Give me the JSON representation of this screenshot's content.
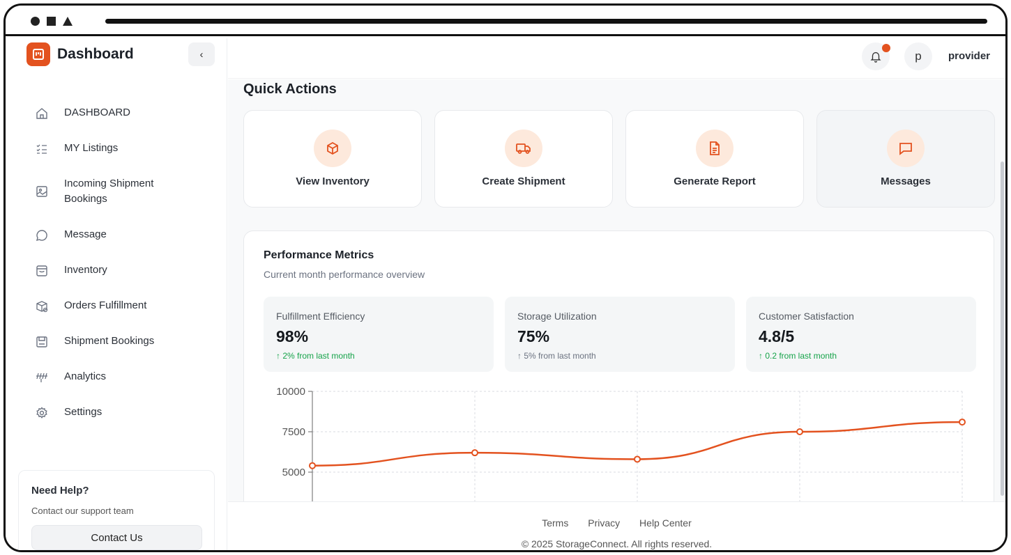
{
  "sidebar": {
    "brand_title": "Dashboard",
    "collapse_symbol": "‹",
    "items": [
      {
        "label": "DASHBOARD",
        "icon": "home-icon"
      },
      {
        "label": "MY Listings",
        "icon": "checklist-icon"
      },
      {
        "label": "Incoming Shipment Bookings",
        "icon": "image-icon"
      },
      {
        "label": "Message",
        "icon": "chat-icon"
      },
      {
        "label": "Inventory",
        "icon": "inbox-icon"
      },
      {
        "label": "Orders Fulfillment",
        "icon": "package-icon"
      },
      {
        "label": "Shipment Bookings",
        "icon": "save-icon"
      },
      {
        "label": "Analytics",
        "icon": "analytics-icon"
      },
      {
        "label": "Settings",
        "icon": "gear-icon"
      }
    ],
    "help": {
      "title": "Need Help?",
      "subtitle": "Contact our support team",
      "button": "Contact Us"
    }
  },
  "topbar": {
    "avatar_initial": "p",
    "username": "provider"
  },
  "quick_actions": {
    "title": "Quick Actions",
    "items": [
      {
        "label": "View Inventory",
        "icon": "box-icon"
      },
      {
        "label": "Create Shipment",
        "icon": "truck-icon"
      },
      {
        "label": "Generate Report",
        "icon": "document-icon"
      },
      {
        "label": "Messages",
        "icon": "message-icon"
      }
    ]
  },
  "performance": {
    "title": "Performance Metrics",
    "subtitle": "Current month performance overview",
    "metrics": [
      {
        "label": "Fulfillment Efficiency",
        "value": "98%",
        "change": "↑ 2% from last month"
      },
      {
        "label": "Storage Utilization",
        "value": "75%",
        "change": "↑ 5% from last month"
      },
      {
        "label": "Customer Satisfaction",
        "value": "4.8/5",
        "change": "↑ 0.2 from last month"
      }
    ]
  },
  "chart_data": {
    "type": "line",
    "x": [
      0,
      1,
      2,
      3,
      4
    ],
    "series": [
      {
        "values": [
          5400,
          6200,
          5800,
          7500,
          8100
        ]
      }
    ],
    "yticks": [
      5000,
      7500,
      10000
    ],
    "ylim": [
      4000,
      10000
    ],
    "grid": true,
    "line_color": "#e3521f"
  },
  "footer": {
    "links": [
      "Terms",
      "Privacy",
      "Help Center"
    ],
    "copyright": "© 2025 StorageConnect. All rights reserved."
  },
  "colors": {
    "accent": "#e3521f",
    "accent_light": "#fde9dc",
    "positive": "#16a34a"
  }
}
